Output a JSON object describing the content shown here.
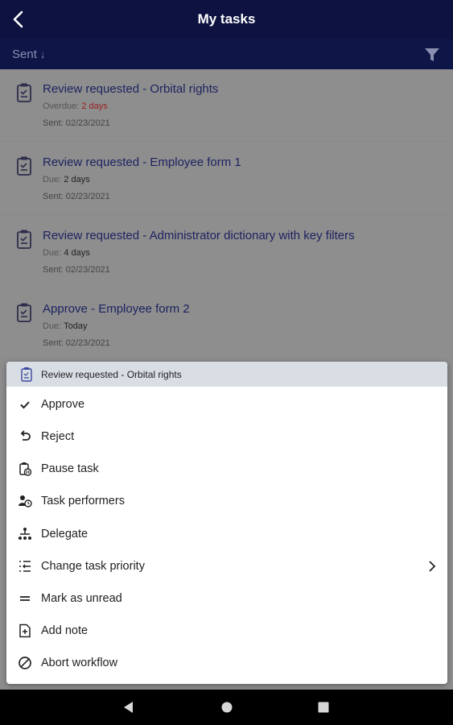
{
  "header": {
    "title": "My tasks",
    "back_icon": "back-arrow-icon"
  },
  "sortbar": {
    "sort_label": "Sent",
    "sort_arrow": "↓",
    "filter_icon": "filter-icon"
  },
  "tasks": [
    {
      "title": "Review requested - Orbital rights",
      "due_label": "Overdue:",
      "due_value": "2 days",
      "due_overdue": true,
      "sent": "Sent: 02/23/2021"
    },
    {
      "title": "Review requested - Employee form 1",
      "due_label": "Due:",
      "due_value": "2 days",
      "due_overdue": false,
      "sent": "Sent: 02/23/2021"
    },
    {
      "title": "Review requested - Administrator dictionary with key filters",
      "due_label": "Due:",
      "due_value": "4 days",
      "due_overdue": false,
      "sent": "Sent: 02/23/2021"
    },
    {
      "title": "Approve - Employee form 2",
      "due_label": "Due:",
      "due_value": "Today",
      "due_overdue": false,
      "sent": "Sent: 02/23/2021"
    }
  ],
  "menu": {
    "header_title": "Review requested - Orbital rights",
    "items": [
      {
        "label": "Approve",
        "icon": "check-icon"
      },
      {
        "label": "Reject",
        "icon": "undo-icon"
      },
      {
        "label": "Pause task",
        "icon": "pause-task-icon"
      },
      {
        "label": "Task performers",
        "icon": "performers-icon"
      },
      {
        "label": "Delegate",
        "icon": "delegate-icon"
      },
      {
        "label": "Change task priority",
        "icon": "priority-icon"
      },
      {
        "label": "Mark as unread",
        "icon": "mark-unread-icon"
      },
      {
        "label": "Add note",
        "icon": "add-note-icon"
      },
      {
        "label": "Abort workflow",
        "icon": "abort-icon"
      }
    ]
  },
  "colors": {
    "topbar": "#0d1240",
    "overdue": "#9a2020",
    "task_title": "#1d2360"
  }
}
